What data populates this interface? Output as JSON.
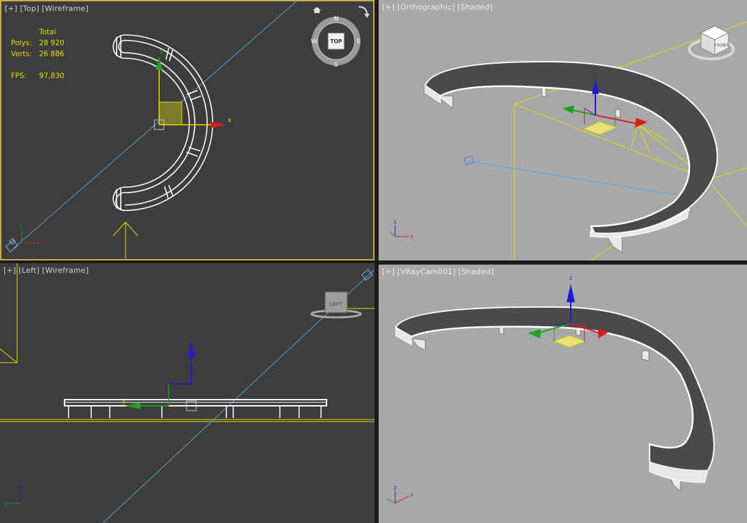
{
  "viewports": {
    "top": {
      "label": "[+] [Top] [Wireframe]"
    },
    "persp": {
      "label": "[+] [Orthographic] [Shaded]"
    },
    "left": {
      "label": "[+] [Left] [Wireframe]"
    },
    "cam": {
      "label": "[+] [VRayCam001] [Shaded]"
    }
  },
  "stats": {
    "header": "Total",
    "polys_label": "Polys:",
    "polys_value": "28 920",
    "verts_label": "Verts:",
    "verts_value": "26 886",
    "fps_label": "FPS:",
    "fps_value": "97,830"
  },
  "viewcube": {
    "top_face": "TOP",
    "front_face": "FRONT",
    "left_face": "LEFT",
    "compass": {
      "n": "N",
      "s": "S",
      "e": "E",
      "w": "W"
    }
  },
  "axes": {
    "x": "x",
    "y": "y",
    "z": "z"
  },
  "colors": {
    "dark_bg": "#3c3c3c",
    "light_bg": "#a7a7a7",
    "active_border": "#c9b046",
    "wire": "#ffffff",
    "gizmo_x": "#d51e1e",
    "gizmo_y": "#1fa01f",
    "gizmo_z": "#1c1cd8",
    "camera_line": "#4ea6e0",
    "selection_yellow": "#e6e100"
  }
}
